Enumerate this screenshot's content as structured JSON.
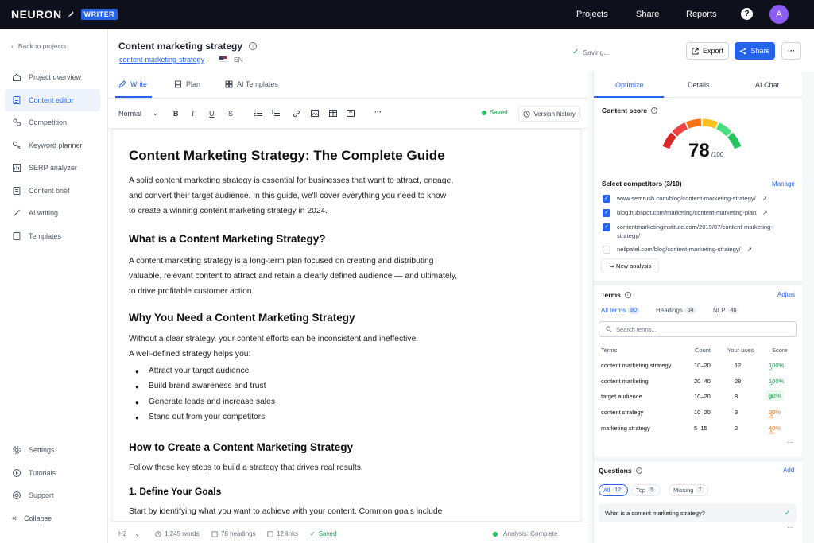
{
  "topbar": {
    "logo_text": "NEURON",
    "logo_badge": "WRITER",
    "nav": [
      "Projects",
      "Share",
      "Reports"
    ],
    "help": "?",
    "avatar_initial": "A"
  },
  "sidebar": {
    "back": "Back to projects",
    "items": [
      {
        "label": "Project overview",
        "icon": "home-icon"
      },
      {
        "label": "Content editor",
        "icon": "document-icon",
        "active": true
      },
      {
        "label": "Competition",
        "icon": "competition-icon"
      },
      {
        "label": "Keyword planner",
        "icon": "key-icon"
      },
      {
        "label": "SERP analyzer",
        "icon": "chart-icon"
      },
      {
        "label": "Content brief",
        "icon": "brief-icon"
      },
      {
        "label": "AI writing",
        "icon": "magic-wand-icon"
      },
      {
        "label": "Templates",
        "icon": "template-icon"
      }
    ],
    "bottom": [
      {
        "label": "Settings",
        "icon": "gear-icon"
      },
      {
        "label": "Tutorials",
        "icon": "play-icon"
      },
      {
        "label": "Support",
        "icon": "support-icon"
      },
      {
        "label": "Collapse",
        "icon": "collapse-icon"
      }
    ]
  },
  "header": {
    "title": "Content marketing strategy",
    "slug": "content-marketing-strategy",
    "language": "EN",
    "saving": "Saving...",
    "export_label": "Export",
    "share_label": "Share",
    "more_label": "···"
  },
  "editor": {
    "tabs": [
      "Write",
      "Plan",
      "AI Templates"
    ],
    "style_select": "Normal",
    "saved": "Saved",
    "version_history": "Version history",
    "h1": "Content Marketing Strategy: The Complete Guide",
    "intro": [
      "A solid content marketing strategy is essential for businesses that want to attract, engage,",
      "and convert their target audience. In this guide, we'll cover everything you need to know",
      "to create a winning content marketing strategy in 2024."
    ],
    "h2_1": "What is a Content Marketing Strategy?",
    "p2": [
      "A content marketing strategy is a long-term plan focused on creating and distributing",
      "valuable, relevant content to attract and retain a clearly defined audience — and ultimately,",
      "to drive profitable customer action."
    ],
    "h2_2": "Why You Need a Content Marketing Strategy",
    "p3": [
      "Without a clear strategy, your content efforts can be inconsistent and ineffective.",
      "A well-defined strategy helps you:"
    ],
    "bullets": [
      "Attract your target audience",
      "Build brand awareness and trust",
      "Generate leads and increase sales",
      "Stand out from your competitors"
    ],
    "h2_3": "How to Create a Content Marketing Strategy",
    "p4": "Follow these key steps to build a strategy that drives real results.",
    "h3_1": "1. Define Your Goals",
    "p5": "Start by identifying what you want to achieve with your content. Common goals include"
  },
  "status": {
    "block": "H2",
    "words": "1,245 words",
    "headings": "78 headings",
    "links": "12 links",
    "saved": "Saved",
    "analysis": "Analysis: Complete"
  },
  "panel": {
    "tabs": [
      "Optimize",
      "Details",
      "AI Chat"
    ],
    "content_score_label": "Content score",
    "score": "78",
    "score_max": "/100",
    "score_fraction": 0.78,
    "competitors_title": "Select competitors (3/10)",
    "manage": "Manage",
    "competitors": [
      {
        "url": "www.semrush.com/blog/content-marketing-strategy/",
        "checked": true
      },
      {
        "url": "blog.hubspot.com/marketing/content-marketing-plan",
        "checked": true
      },
      {
        "url": "contentmarketinginstitute.com/2019/07/content-marketing-strategy/",
        "checked": true
      },
      {
        "url": "neilpatel.com/blog/content-marketing-strategy/",
        "checked": false
      }
    ],
    "new_analysis": "New analysis",
    "terms_title": "Terms",
    "adjust": "Adjust",
    "term_tabs": [
      {
        "label": "All terms",
        "count": "80"
      },
      {
        "label": "Headings",
        "count": "34"
      },
      {
        "label": "NLP",
        "count": "46"
      }
    ],
    "search_placeholder": "Search terms...",
    "table_headers": [
      "Terms",
      "Count",
      "Your uses",
      "Score"
    ],
    "terms": [
      {
        "term": "content marketing strategy",
        "count": "10–20",
        "uses": "12",
        "score": "100%",
        "status": "good"
      },
      {
        "term": "content marketing",
        "count": "20–40",
        "uses": "28",
        "score": "100%",
        "status": "good"
      },
      {
        "term": "target audience",
        "count": "10–20",
        "uses": "8",
        "score": "80%",
        "status": "good"
      },
      {
        "term": "content strategy",
        "count": "10–20",
        "uses": "3",
        "score": "30%",
        "status": "warn"
      },
      {
        "term": "marketing strategy",
        "count": "5–15",
        "uses": "2",
        "score": "40%",
        "status": "warn"
      }
    ],
    "terms_more": "···",
    "questions_title": "Questions",
    "add": "Add",
    "question_tabs": [
      {
        "label": "All",
        "count": "12"
      },
      {
        "label": "Top",
        "count": "5"
      },
      {
        "label": "Missing",
        "count": "7"
      }
    ],
    "questions": [
      "What is a content marketing strategy?"
    ],
    "questions_more": "···"
  }
}
